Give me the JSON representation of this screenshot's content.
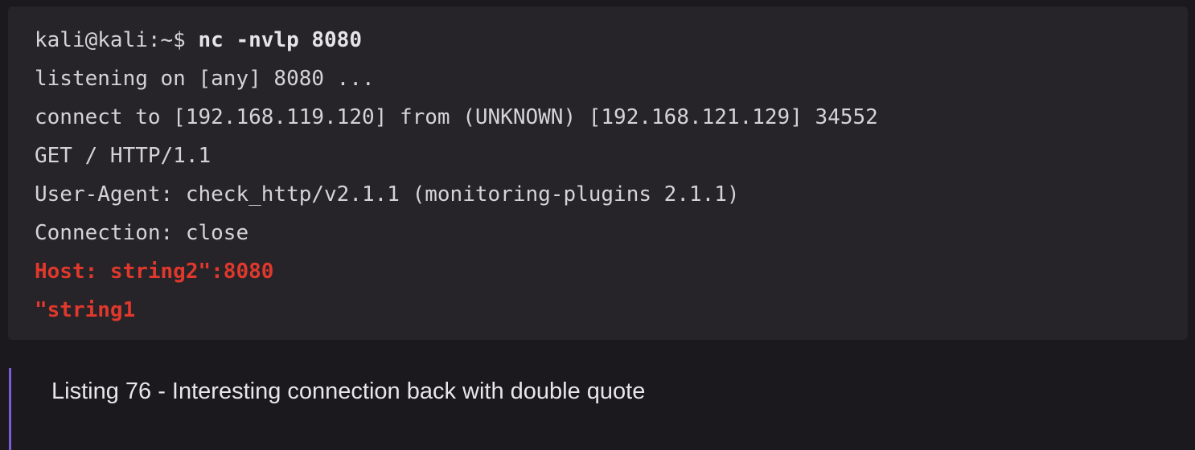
{
  "terminal": {
    "prompt": "kali@kali:~$ ",
    "command": "nc -nvlp 8080",
    "output": [
      "listening on [any] 8080 ...",
      "connect to [192.168.119.120] from (UNKNOWN) [192.168.121.129] 34552",
      "GET / HTTP/1.1",
      "User-Agent: check_http/v2.1.1 (monitoring-plugins 2.1.1)",
      "Connection: close"
    ],
    "highlighted": [
      "Host: string2\":8080",
      "\"string1"
    ],
    "highlight_color": "#e0382c"
  },
  "caption": {
    "text": "Listing 76 - Interesting connection back with double quote",
    "accent_color": "#7b5cd6"
  }
}
